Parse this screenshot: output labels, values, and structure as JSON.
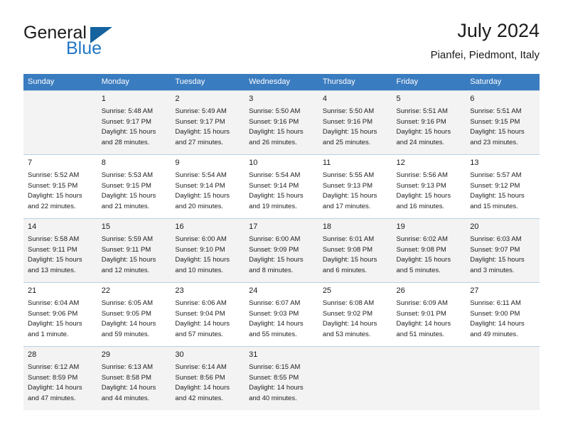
{
  "brand": {
    "name_part1": "General",
    "name_part2": "Blue",
    "triangle_color": "#15639e",
    "blue_color": "#2276c4"
  },
  "header": {
    "title": "July 2024",
    "location": "Pianfei, Piedmont, Italy"
  },
  "theme": {
    "header_row_bg": "#3a7cc0",
    "alt_row_bg": "#f3f3f3",
    "grid_line": "#b9cfe4"
  },
  "calendar": {
    "weekday_headers": [
      "Sunday",
      "Monday",
      "Tuesday",
      "Wednesday",
      "Thursday",
      "Friday",
      "Saturday"
    ],
    "weeks": [
      {
        "shaded": true,
        "days": [
          {
            "empty": true
          },
          {
            "day": "1",
            "sunrise": "Sunrise: 5:48 AM",
            "sunset": "Sunset: 9:17 PM",
            "daylight_line1": "Daylight: 15 hours",
            "daylight_line2": "and 28 minutes."
          },
          {
            "day": "2",
            "sunrise": "Sunrise: 5:49 AM",
            "sunset": "Sunset: 9:17 PM",
            "daylight_line1": "Daylight: 15 hours",
            "daylight_line2": "and 27 minutes."
          },
          {
            "day": "3",
            "sunrise": "Sunrise: 5:50 AM",
            "sunset": "Sunset: 9:16 PM",
            "daylight_line1": "Daylight: 15 hours",
            "daylight_line2": "and 26 minutes."
          },
          {
            "day": "4",
            "sunrise": "Sunrise: 5:50 AM",
            "sunset": "Sunset: 9:16 PM",
            "daylight_line1": "Daylight: 15 hours",
            "daylight_line2": "and 25 minutes."
          },
          {
            "day": "5",
            "sunrise": "Sunrise: 5:51 AM",
            "sunset": "Sunset: 9:16 PM",
            "daylight_line1": "Daylight: 15 hours",
            "daylight_line2": "and 24 minutes."
          },
          {
            "day": "6",
            "sunrise": "Sunrise: 5:51 AM",
            "sunset": "Sunset: 9:15 PM",
            "daylight_line1": "Daylight: 15 hours",
            "daylight_line2": "and 23 minutes."
          }
        ]
      },
      {
        "shaded": false,
        "days": [
          {
            "day": "7",
            "sunrise": "Sunrise: 5:52 AM",
            "sunset": "Sunset: 9:15 PM",
            "daylight_line1": "Daylight: 15 hours",
            "daylight_line2": "and 22 minutes."
          },
          {
            "day": "8",
            "sunrise": "Sunrise: 5:53 AM",
            "sunset": "Sunset: 9:15 PM",
            "daylight_line1": "Daylight: 15 hours",
            "daylight_line2": "and 21 minutes."
          },
          {
            "day": "9",
            "sunrise": "Sunrise: 5:54 AM",
            "sunset": "Sunset: 9:14 PM",
            "daylight_line1": "Daylight: 15 hours",
            "daylight_line2": "and 20 minutes."
          },
          {
            "day": "10",
            "sunrise": "Sunrise: 5:54 AM",
            "sunset": "Sunset: 9:14 PM",
            "daylight_line1": "Daylight: 15 hours",
            "daylight_line2": "and 19 minutes."
          },
          {
            "day": "11",
            "sunrise": "Sunrise: 5:55 AM",
            "sunset": "Sunset: 9:13 PM",
            "daylight_line1": "Daylight: 15 hours",
            "daylight_line2": "and 17 minutes."
          },
          {
            "day": "12",
            "sunrise": "Sunrise: 5:56 AM",
            "sunset": "Sunset: 9:13 PM",
            "daylight_line1": "Daylight: 15 hours",
            "daylight_line2": "and 16 minutes."
          },
          {
            "day": "13",
            "sunrise": "Sunrise: 5:57 AM",
            "sunset": "Sunset: 9:12 PM",
            "daylight_line1": "Daylight: 15 hours",
            "daylight_line2": "and 15 minutes."
          }
        ]
      },
      {
        "shaded": true,
        "days": [
          {
            "day": "14",
            "sunrise": "Sunrise: 5:58 AM",
            "sunset": "Sunset: 9:11 PM",
            "daylight_line1": "Daylight: 15 hours",
            "daylight_line2": "and 13 minutes."
          },
          {
            "day": "15",
            "sunrise": "Sunrise: 5:59 AM",
            "sunset": "Sunset: 9:11 PM",
            "daylight_line1": "Daylight: 15 hours",
            "daylight_line2": "and 12 minutes."
          },
          {
            "day": "16",
            "sunrise": "Sunrise: 6:00 AM",
            "sunset": "Sunset: 9:10 PM",
            "daylight_line1": "Daylight: 15 hours",
            "daylight_line2": "and 10 minutes."
          },
          {
            "day": "17",
            "sunrise": "Sunrise: 6:00 AM",
            "sunset": "Sunset: 9:09 PM",
            "daylight_line1": "Daylight: 15 hours",
            "daylight_line2": "and 8 minutes."
          },
          {
            "day": "18",
            "sunrise": "Sunrise: 6:01 AM",
            "sunset": "Sunset: 9:08 PM",
            "daylight_line1": "Daylight: 15 hours",
            "daylight_line2": "and 6 minutes."
          },
          {
            "day": "19",
            "sunrise": "Sunrise: 6:02 AM",
            "sunset": "Sunset: 9:08 PM",
            "daylight_line1": "Daylight: 15 hours",
            "daylight_line2": "and 5 minutes."
          },
          {
            "day": "20",
            "sunrise": "Sunrise: 6:03 AM",
            "sunset": "Sunset: 9:07 PM",
            "daylight_line1": "Daylight: 15 hours",
            "daylight_line2": "and 3 minutes."
          }
        ]
      },
      {
        "shaded": false,
        "days": [
          {
            "day": "21",
            "sunrise": "Sunrise: 6:04 AM",
            "sunset": "Sunset: 9:06 PM",
            "daylight_line1": "Daylight: 15 hours",
            "daylight_line2": "and 1 minute."
          },
          {
            "day": "22",
            "sunrise": "Sunrise: 6:05 AM",
            "sunset": "Sunset: 9:05 PM",
            "daylight_line1": "Daylight: 14 hours",
            "daylight_line2": "and 59 minutes."
          },
          {
            "day": "23",
            "sunrise": "Sunrise: 6:06 AM",
            "sunset": "Sunset: 9:04 PM",
            "daylight_line1": "Daylight: 14 hours",
            "daylight_line2": "and 57 minutes."
          },
          {
            "day": "24",
            "sunrise": "Sunrise: 6:07 AM",
            "sunset": "Sunset: 9:03 PM",
            "daylight_line1": "Daylight: 14 hours",
            "daylight_line2": "and 55 minutes."
          },
          {
            "day": "25",
            "sunrise": "Sunrise: 6:08 AM",
            "sunset": "Sunset: 9:02 PM",
            "daylight_line1": "Daylight: 14 hours",
            "daylight_line2": "and 53 minutes."
          },
          {
            "day": "26",
            "sunrise": "Sunrise: 6:09 AM",
            "sunset": "Sunset: 9:01 PM",
            "daylight_line1": "Daylight: 14 hours",
            "daylight_line2": "and 51 minutes."
          },
          {
            "day": "27",
            "sunrise": "Sunrise: 6:11 AM",
            "sunset": "Sunset: 9:00 PM",
            "daylight_line1": "Daylight: 14 hours",
            "daylight_line2": "and 49 minutes."
          }
        ]
      },
      {
        "shaded": true,
        "days": [
          {
            "day": "28",
            "sunrise": "Sunrise: 6:12 AM",
            "sunset": "Sunset: 8:59 PM",
            "daylight_line1": "Daylight: 14 hours",
            "daylight_line2": "and 47 minutes."
          },
          {
            "day": "29",
            "sunrise": "Sunrise: 6:13 AM",
            "sunset": "Sunset: 8:58 PM",
            "daylight_line1": "Daylight: 14 hours",
            "daylight_line2": "and 44 minutes."
          },
          {
            "day": "30",
            "sunrise": "Sunrise: 6:14 AM",
            "sunset": "Sunset: 8:56 PM",
            "daylight_line1": "Daylight: 14 hours",
            "daylight_line2": "and 42 minutes."
          },
          {
            "day": "31",
            "sunrise": "Sunrise: 6:15 AM",
            "sunset": "Sunset: 8:55 PM",
            "daylight_line1": "Daylight: 14 hours",
            "daylight_line2": "and 40 minutes."
          },
          {
            "empty": true
          },
          {
            "empty": true
          },
          {
            "empty": true
          }
        ]
      }
    ]
  }
}
